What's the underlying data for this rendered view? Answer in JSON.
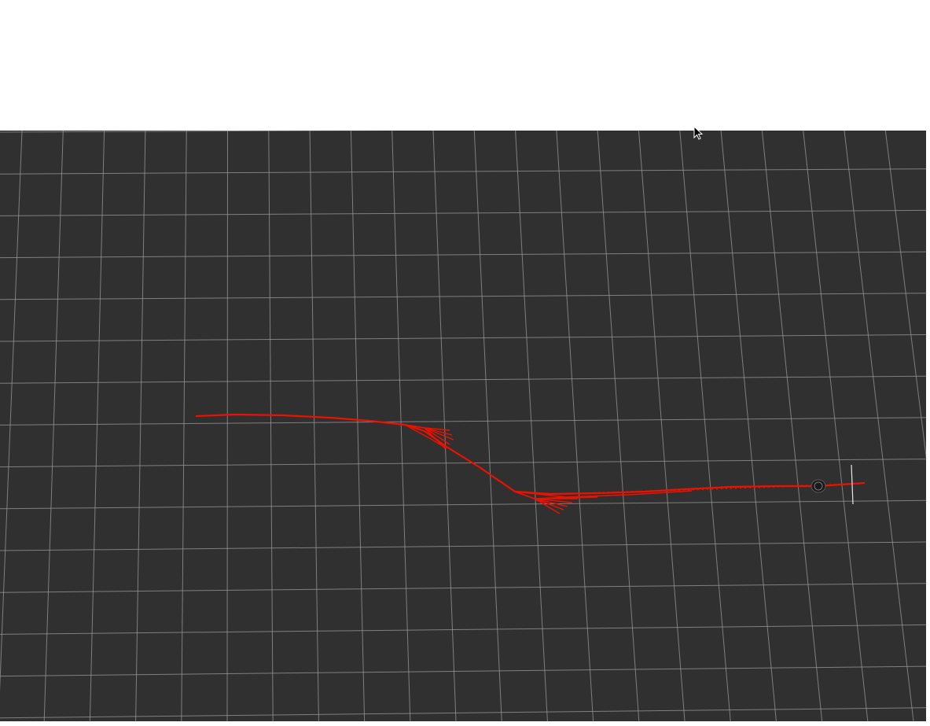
{
  "window": {
    "view_type": "3D visualization viewport"
  },
  "scene": {
    "background_color": "#303030",
    "grid_color": "#9a9a9a",
    "path_color": "#ee1100",
    "robot_color": "#1a1a1a",
    "axis_marker_color": "#e8e8e8"
  },
  "icons": {
    "cursor": "mouse-pointer-icon",
    "robot": "robot-model-icon"
  }
}
